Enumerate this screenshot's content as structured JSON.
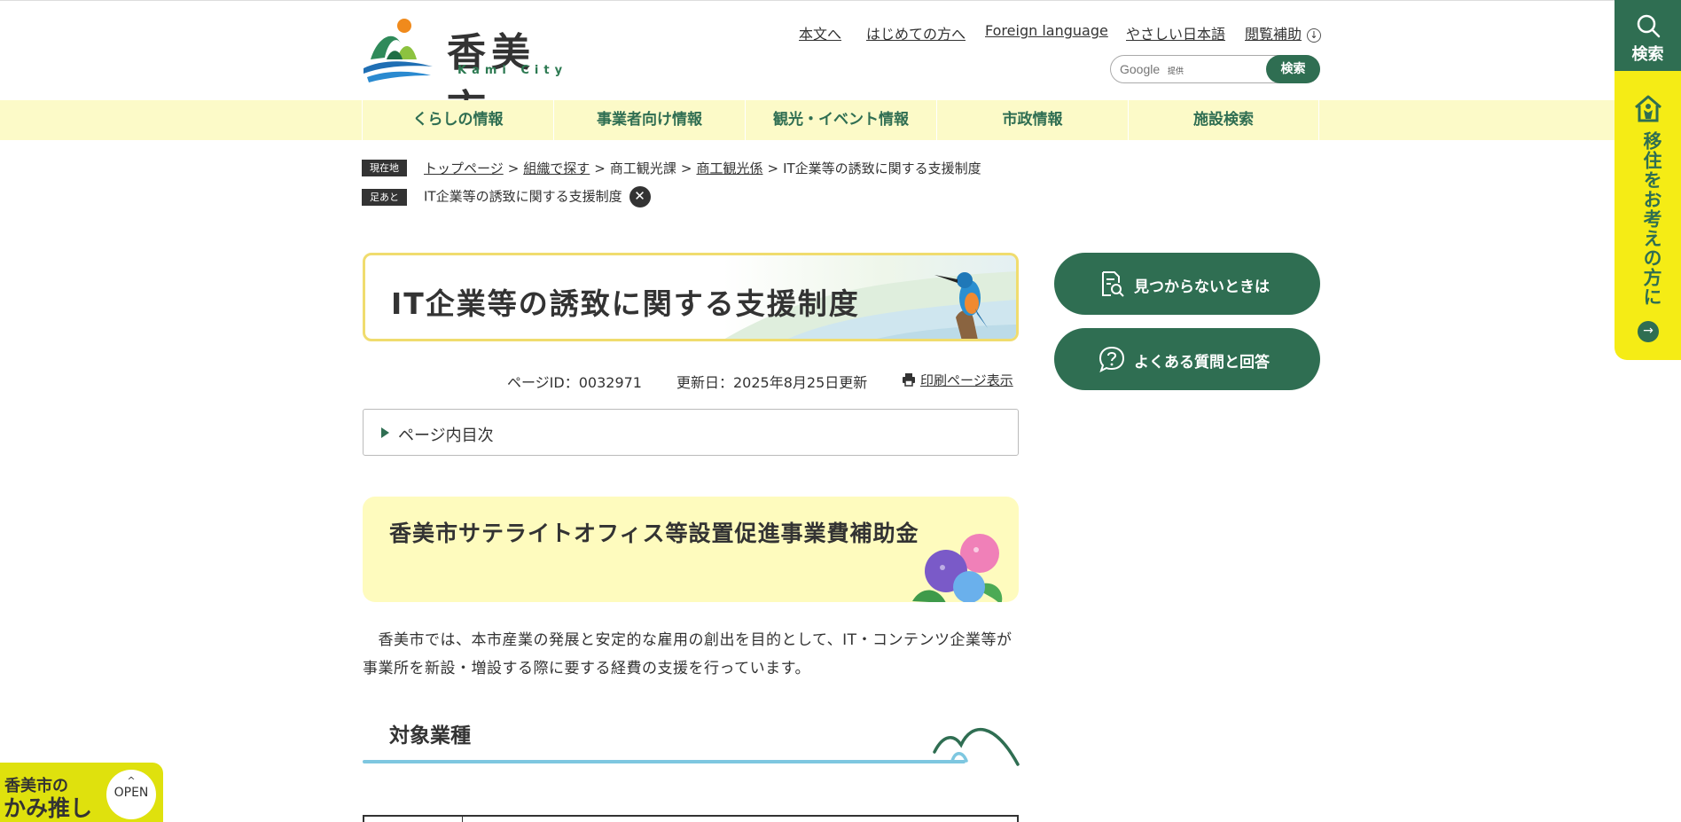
{
  "header": {
    "logo_title": "香美市",
    "logo_sub": "Kami City",
    "util_links": [
      "本文へ",
      "はじめての方へ",
      "Foreign language",
      "やさしい日本語",
      "閲覧補助"
    ],
    "search": {
      "placeholder": "Google",
      "provided": "提供",
      "button": "検索"
    }
  },
  "gnav": [
    "くらしの情報",
    "事業者向け情報",
    "観光・イベント情報",
    "市政情報",
    "施設検索"
  ],
  "side": {
    "search_label": "検索",
    "move_label": "移住をお考えの方に",
    "arrow": "→"
  },
  "breadcrumb": {
    "current_tag": "現在地",
    "items": [
      "トップページ",
      "組織で探す",
      "商工観光課",
      "商工観光係",
      "IT企業等の誘致に関する支援制度"
    ],
    "sep": ">",
    "history_tag": "足あと",
    "history_item": "IT企業等の誘致に関する支援制度",
    "close": "✕"
  },
  "page": {
    "title": "IT企業等の誘致に関する支援制度",
    "page_id": "ページID：0032971",
    "updated": "更新日：2025年8月25日更新",
    "print": "印刷ページ表示",
    "toc": "ページ内目次",
    "h2": "香美市サテライトオフィス等設置促進事業費補助金",
    "body": "　香美市では、本市産業の発展と安定的な雇用の創出を目的として、IT・コンテンツ企業等が事業所を新設・増設する際に要する経費の支援を行っています。",
    "h3": "対象業種"
  },
  "right_buttons": [
    "見つからないときは",
    "よくある質問と回答"
  ],
  "kami": {
    "line1": "香美市の",
    "line2": "かみ推し",
    "open": "OPEN",
    "caret": "^"
  },
  "colors": {
    "brand_green": "#2f6e52",
    "nav_yellow": "#fcfac8",
    "side_yellow": "#f5ec15",
    "heading_yellow": "#fefbbe",
    "title_border": "#f0dc6e",
    "accent_blue": "#7ec7e0"
  }
}
